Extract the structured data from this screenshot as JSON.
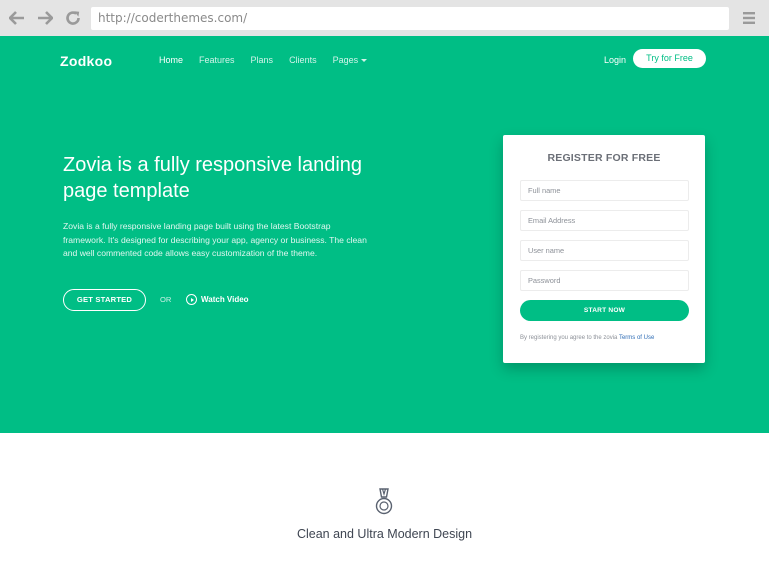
{
  "browser": {
    "url": "http://coderthemes.com/"
  },
  "site": {
    "logo": "Zodkoo",
    "nav": [
      {
        "label": "Home"
      },
      {
        "label": "Features"
      },
      {
        "label": "Plans"
      },
      {
        "label": "Clients"
      },
      {
        "label": "Pages"
      }
    ],
    "login_label": "Login",
    "try_label": "Try for Free"
  },
  "hero": {
    "title": "Zovia is a fully responsive landing page template",
    "description": "Zovia is a fully responsive landing page built using the latest Bootstrap framework. It's designed for describing your app, agency or business. The clean and well commented code allows easy customization of the theme.",
    "get_started_label": "GET STARTED",
    "or_label": "OR",
    "watch_label": "Watch Video"
  },
  "register": {
    "title": "REGISTER FOR FREE",
    "fields": [
      {
        "placeholder": "Full name"
      },
      {
        "placeholder": "Email Address"
      },
      {
        "placeholder": "User name"
      },
      {
        "placeholder": "Password"
      }
    ],
    "start_label": "START NOW",
    "terms_prefix": "By registering you agree to the zovia",
    "terms_link": "Terms of Use"
  },
  "features": {
    "title": "Clean and Ultra Modern Design"
  },
  "colors": {
    "accent": "#00be85",
    "chrome": "#e4e4e4",
    "link": "#2f6db5"
  },
  "icons": {
    "back": "arrow-left-icon",
    "forward": "arrow-right-icon",
    "reload": "reload-icon",
    "menu": "hamburger-menu-icon",
    "dropdown": "caret-down-icon",
    "play": "play-circle-icon",
    "feature": "medal-icon"
  }
}
